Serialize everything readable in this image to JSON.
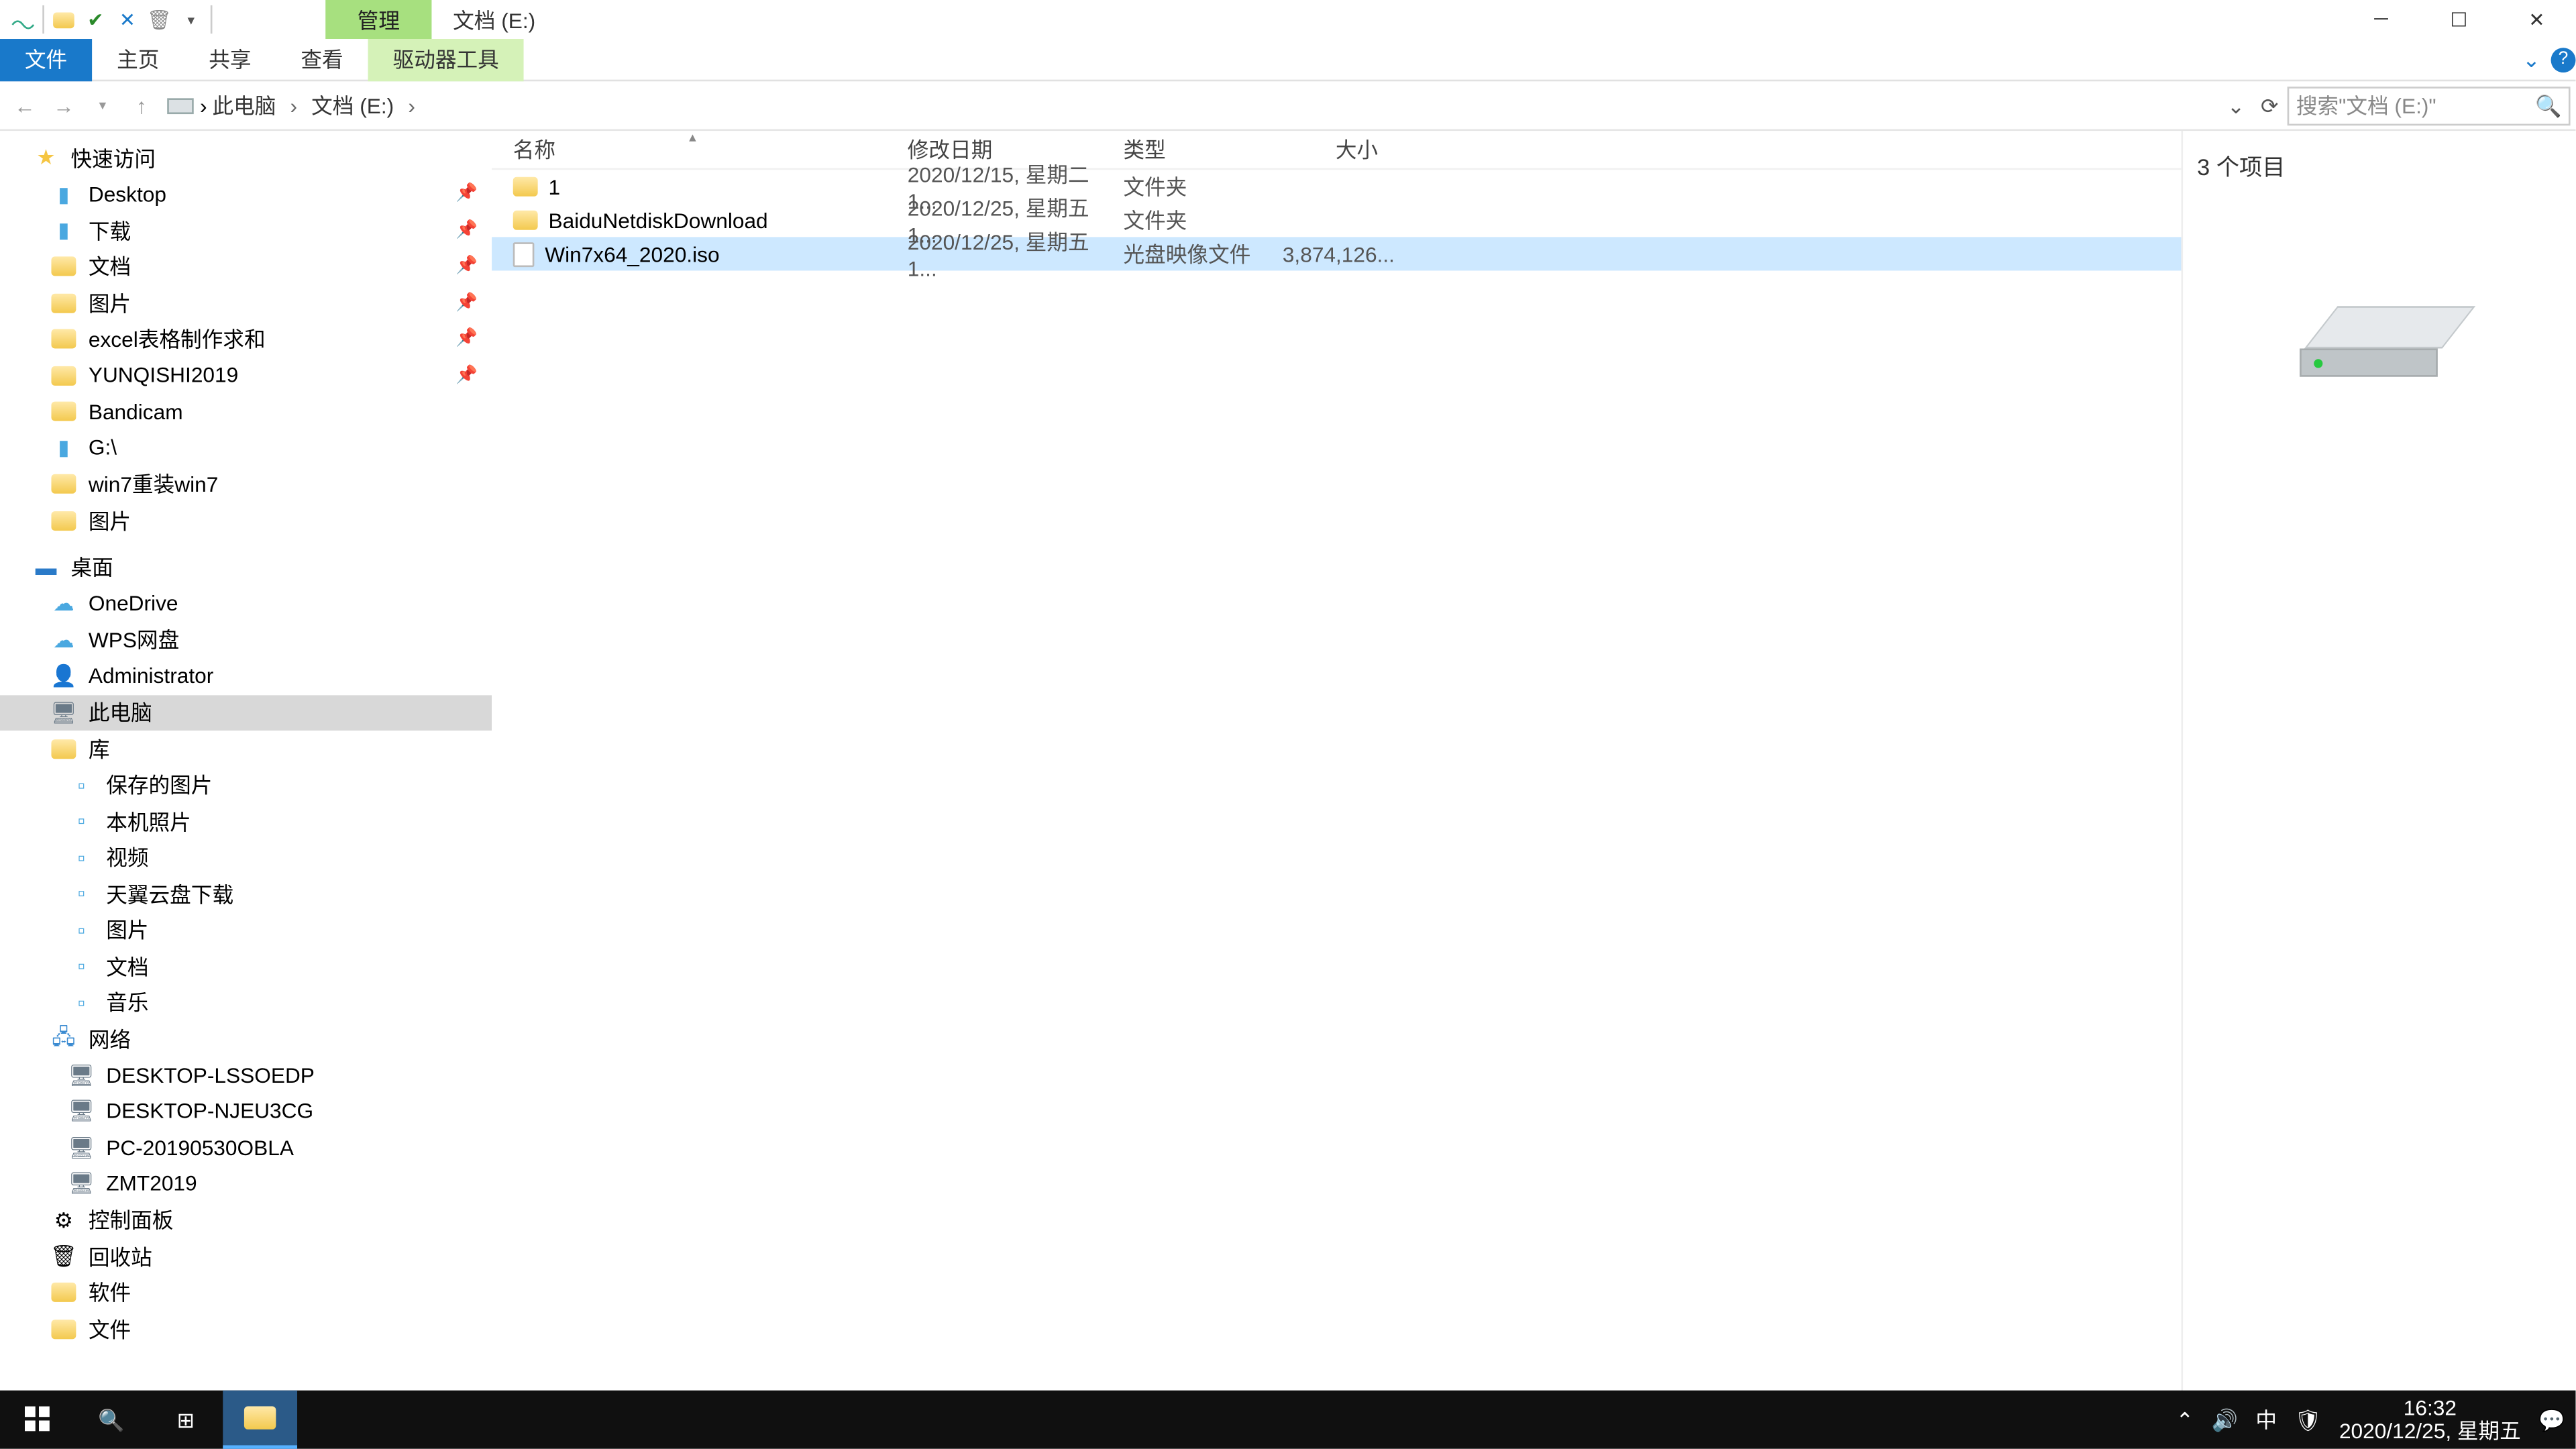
{
  "title": {
    "context_tab": "管理",
    "window_title": "文档 (E:)"
  },
  "ribbon": {
    "tabs": [
      "文件",
      "主页",
      "共享",
      "查看"
    ],
    "context_tab": "驱动器工具"
  },
  "address": {
    "crumbs": [
      "此电脑",
      "文档 (E:)"
    ],
    "search_placeholder": "搜索\"文档 (E:)\""
  },
  "columns": {
    "name": "名称",
    "date": "修改日期",
    "type": "类型",
    "size": "大小"
  },
  "files": [
    {
      "icon": "folder",
      "name": "1",
      "date": "2020/12/15, 星期二 1...",
      "type": "文件夹",
      "size": "",
      "selected": false
    },
    {
      "icon": "folder",
      "name": "BaiduNetdiskDownload",
      "date": "2020/12/25, 星期五 1...",
      "type": "文件夹",
      "size": "",
      "selected": false
    },
    {
      "icon": "iso",
      "name": "Win7x64_2020.iso",
      "date": "2020/12/25, 星期五 1...",
      "type": "光盘映像文件",
      "size": "3,874,126...",
      "selected": true
    }
  ],
  "nav": {
    "quick_access": "快速访问",
    "qa_items": [
      {
        "icon": "blue",
        "label": "Desktop",
        "pin": true
      },
      {
        "icon": "blue",
        "label": "下载",
        "pin": true
      },
      {
        "icon": "fold",
        "label": "文档",
        "pin": true
      },
      {
        "icon": "fold",
        "label": "图片",
        "pin": true
      },
      {
        "icon": "fold",
        "label": "excel表格制作求和",
        "pin": true
      },
      {
        "icon": "fold",
        "label": "YUNQISHI2019",
        "pin": true
      },
      {
        "icon": "fold",
        "label": "Bandicam",
        "pin": false
      },
      {
        "icon": "blue",
        "label": "G:\\",
        "pin": false
      },
      {
        "icon": "fold",
        "label": "win7重装win7",
        "pin": false
      },
      {
        "icon": "fold",
        "label": "图片",
        "pin": false
      }
    ],
    "desktop": "桌面",
    "dt_items": [
      {
        "icon": "blue",
        "label": "OneDrive"
      },
      {
        "icon": "blue",
        "label": "WPS网盘"
      },
      {
        "icon": "user",
        "label": "Administrator"
      },
      {
        "icon": "pc",
        "label": "此电脑",
        "selected": true
      },
      {
        "icon": "fold",
        "label": "库"
      }
    ],
    "lib_items": [
      "保存的图片",
      "本机照片",
      "视频",
      "天翼云盘下载",
      "图片",
      "文档",
      "音乐"
    ],
    "network": "网络",
    "net_items": [
      "DESKTOP-LSSOEDP",
      "DESKTOP-NJEU3CG",
      "PC-20190530OBLA",
      "ZMT2019"
    ],
    "bottom": [
      "控制面板",
      "回收站",
      "软件",
      "文件"
    ]
  },
  "preview": {
    "count": "3 个项目"
  },
  "status": {
    "text": "3 个项目"
  },
  "taskbar": {
    "time": "16:32",
    "date": "2020/12/25, 星期五",
    "ime": "中"
  }
}
